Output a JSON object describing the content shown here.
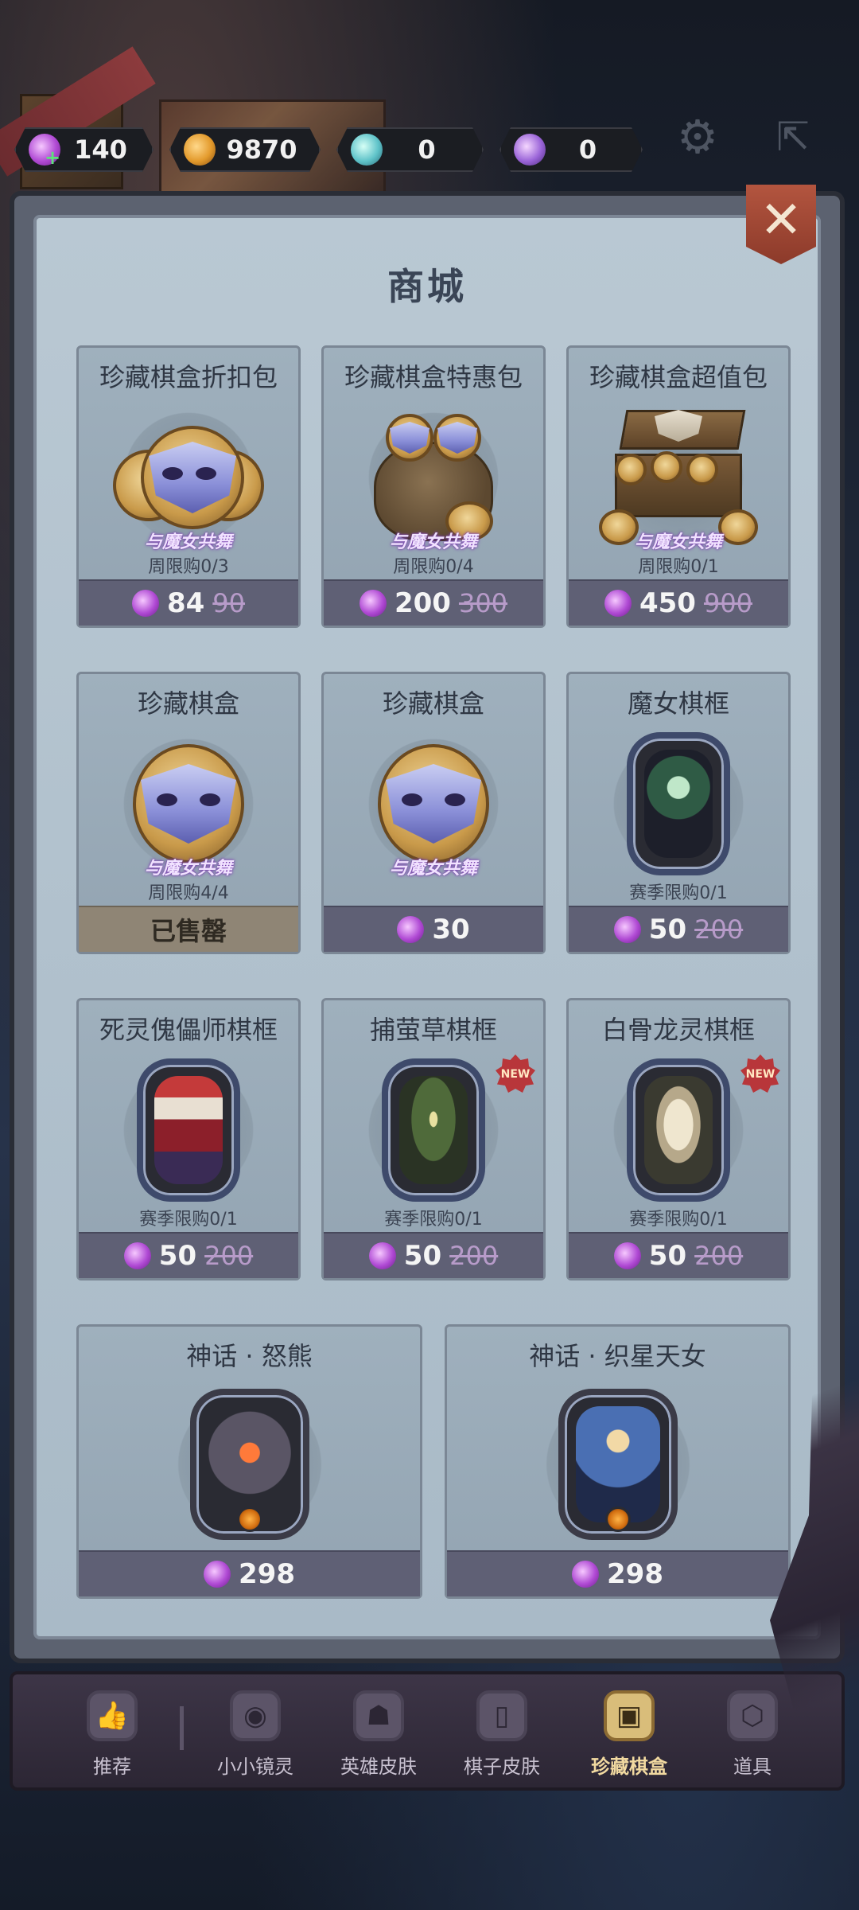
{
  "currencies": [
    {
      "icon": "candy-icon",
      "value": "140",
      "has_plus": true
    },
    {
      "icon": "pumpkin-coin-icon",
      "value": "9870"
    },
    {
      "icon": "potion-icon",
      "value": "0"
    },
    {
      "icon": "orb-icon",
      "value": "0"
    }
  ],
  "top_actions": {
    "settings_icon": "gear-icon",
    "exit_icon": "exit-icon"
  },
  "panel": {
    "title": "商城",
    "close_icon": "close-icon",
    "close_glyph": "✕"
  },
  "products": [
    {
      "title": "珍藏棋盒折扣包",
      "tag": "与魔女共舞",
      "limit": "周限购0/3",
      "price": "84",
      "old_price": "90",
      "art": "mask-coins"
    },
    {
      "title": "珍藏棋盒特惠包",
      "tag": "与魔女共舞",
      "limit": "周限购0/4",
      "price": "200",
      "old_price": "300",
      "art": "mask-sack"
    },
    {
      "title": "珍藏棋盒超值包",
      "tag": "与魔女共舞",
      "limit": "周限购0/1",
      "price": "450",
      "old_price": "900",
      "art": "mask-chest"
    },
    {
      "title": "珍藏棋盒",
      "tag": "与魔女共舞",
      "limit": "周限购4/4",
      "sold_out_label": "已售罄",
      "art": "mask-single"
    },
    {
      "title": "珍藏棋盒",
      "tag": "与魔女共舞",
      "limit": "",
      "price": "30",
      "art": "mask-single"
    },
    {
      "title": "魔女棋框",
      "limit": "赛季限购0/1",
      "price": "50",
      "old_price": "200",
      "art": "witch-frame"
    },
    {
      "title": "死灵傀儡师棋框",
      "limit": "赛季限购0/1",
      "price": "50",
      "old_price": "200",
      "art": "puppeteer-frame"
    },
    {
      "title": "捕萤草棋框",
      "limit": "赛季限购0/1",
      "price": "50",
      "old_price": "200",
      "art": "plant-frame",
      "badge": "NEW"
    },
    {
      "title": "白骨龙灵棋框",
      "limit": "赛季限购0/1",
      "price": "50",
      "old_price": "200",
      "art": "bone-dragon-frame",
      "badge": "NEW"
    },
    {
      "title": "神话 · 怒熊",
      "price": "298",
      "art": "bear-frame"
    },
    {
      "title": "神话 · 织星天女",
      "price": "298",
      "art": "star-weaver-frame"
    }
  ],
  "nav": [
    {
      "label": "推荐",
      "icon": "thumbs-up-icon",
      "glyph": "👍",
      "active": false
    },
    {
      "label": "小小镜灵",
      "icon": "ghost-card-icon",
      "glyph": "◉",
      "active": false
    },
    {
      "label": "英雄皮肤",
      "icon": "hero-skin-icon",
      "glyph": "☗",
      "active": false
    },
    {
      "label": "棋子皮肤",
      "icon": "piece-skin-icon",
      "glyph": "▯",
      "active": false
    },
    {
      "label": "珍藏棋盒",
      "icon": "collector-box-icon",
      "glyph": "▣",
      "active": true
    },
    {
      "label": "道具",
      "icon": "items-icon",
      "glyph": "⬡",
      "active": false
    }
  ],
  "colors": {
    "accent_gold": "#d9bd7a",
    "price_bar": "#5f6075",
    "candy": "#b04ad4",
    "close": "#b3553f"
  }
}
